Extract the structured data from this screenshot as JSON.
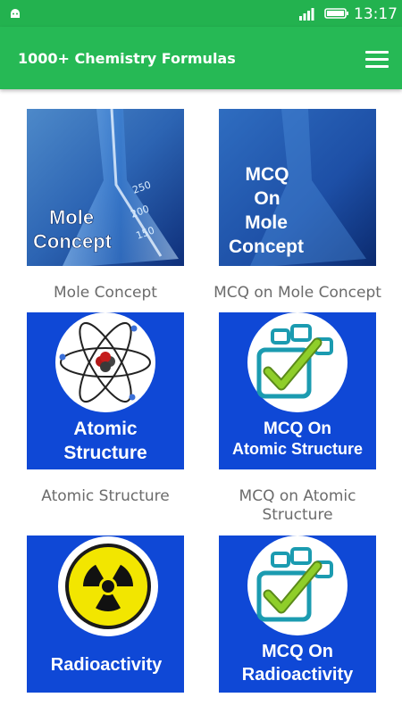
{
  "status_bar": {
    "time": "13:17"
  },
  "app_bar": {
    "title": "1000+ Chemistry Formulas"
  },
  "grid": [
    {
      "image_text": [
        "Mole",
        "Concept"
      ],
      "caption": "Mole Concept"
    },
    {
      "image_text": [
        "MCQ",
        "On",
        "Mole",
        "Concept"
      ],
      "caption": "MCQ on Mole Concept"
    },
    {
      "image_text": [
        "Atomic",
        "Structure"
      ],
      "caption": "Atomic Structure"
    },
    {
      "image_text": [
        "MCQ On",
        "Atomic Structure"
      ],
      "caption": "MCQ on Atomic Structure"
    },
    {
      "image_text": [
        "Radioactivity"
      ],
      "caption": ""
    },
    {
      "image_text": [
        "MCQ On",
        "Radioactivity"
      ],
      "caption": ""
    }
  ],
  "colors": {
    "status_bar": "#23b24f",
    "app_bar": "#26b955",
    "tile_blue": "#0f48d6"
  }
}
